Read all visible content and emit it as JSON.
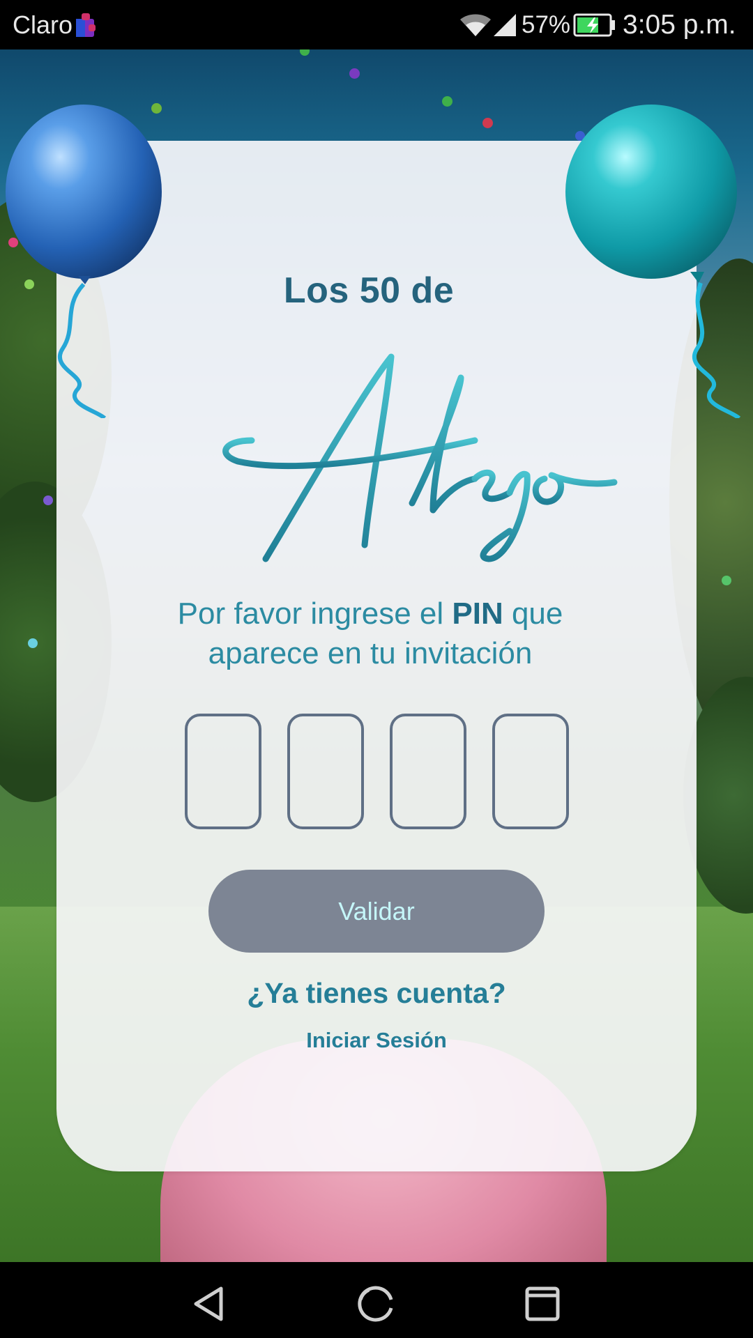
{
  "status_bar": {
    "carrier": "Claro",
    "battery_percent": "57%",
    "time": "3:05 p.m.",
    "icons": [
      "carrier-badge-icon",
      "wifi-icon",
      "signal-icon",
      "battery-charging-icon"
    ]
  },
  "card": {
    "subtitle": "Los 50 de",
    "title": "Alejo",
    "instructions_before": "Por favor ingrese el ",
    "instructions_emphasis": "PIN",
    "instructions_after": " que aparece en tu invitación",
    "pin_boxes": [
      "",
      "",
      "",
      ""
    ],
    "validate_label": "Validar",
    "account_question": "¿Ya tienes cuenta?",
    "login_label": "Iniciar Sesión"
  },
  "decorations": {
    "balloon_left_color": "#2c6fc3",
    "balloon_right_color": "#1cb1b8"
  },
  "colors": {
    "accent": "#2b8ba2",
    "dark_accent": "#25637d",
    "button": "#7d8594",
    "button_text": "#c5f6f9",
    "pin_border": "#5f6f85"
  },
  "nav_bar": {
    "buttons": [
      "back-icon",
      "home-icon",
      "recents-icon"
    ]
  }
}
